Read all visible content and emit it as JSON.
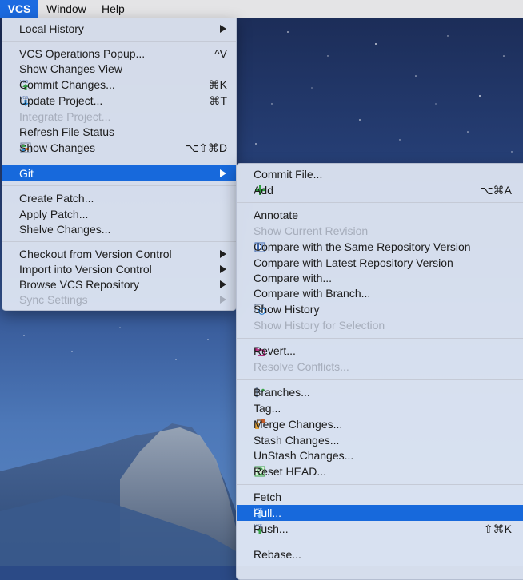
{
  "menubar": {
    "items": [
      "VCS",
      "Window",
      "Help"
    ],
    "active": "VCS"
  },
  "vcs_menu": {
    "items": [
      {
        "label": "Local History",
        "submenu": true
      },
      {
        "label": "VCS Operations Popup...",
        "shortcut": "^V"
      },
      {
        "label": "Show Changes View"
      },
      {
        "label": "Commit Changes...",
        "shortcut": "⌘K",
        "icon": "vcs-commit-icon"
      },
      {
        "label": "Update Project...",
        "shortcut": "⌘T",
        "icon": "vcs-update-icon"
      },
      {
        "label": "Integrate Project...",
        "disabled": true
      },
      {
        "label": "Refresh File Status"
      },
      {
        "label": "Show Changes",
        "shortcut": "⌥⇧⌘D",
        "icon": "show-changes-icon"
      },
      {
        "label": "Git",
        "submenu": true,
        "highlighted": true
      },
      {
        "label": "Create Patch..."
      },
      {
        "label": "Apply Patch..."
      },
      {
        "label": "Shelve Changes..."
      },
      {
        "label": "Checkout from Version Control",
        "submenu": true
      },
      {
        "label": "Import into Version Control",
        "submenu": true
      },
      {
        "label": "Browse VCS Repository",
        "submenu": true
      },
      {
        "label": "Sync Settings",
        "submenu": true,
        "disabled": true
      }
    ]
  },
  "git_menu": {
    "items": [
      {
        "label": "Commit File..."
      },
      {
        "label": "Add",
        "shortcut": "⌥⌘A",
        "icon": "plus-icon"
      },
      {
        "label": "Annotate"
      },
      {
        "label": "Show Current Revision",
        "disabled": true
      },
      {
        "label": "Compare with the Same Repository Version",
        "icon": "compare-icon"
      },
      {
        "label": "Compare with Latest Repository Version"
      },
      {
        "label": "Compare with..."
      },
      {
        "label": "Compare with Branch..."
      },
      {
        "label": "Show History",
        "icon": "history-icon"
      },
      {
        "label": "Show History for Selection",
        "disabled": true
      },
      {
        "label": "Revert...",
        "icon": "revert-icon"
      },
      {
        "label": "Resolve Conflicts...",
        "disabled": true
      },
      {
        "label": "Branches...",
        "icon": "branches-icon"
      },
      {
        "label": "Tag..."
      },
      {
        "label": "Merge Changes...",
        "icon": "merge-icon"
      },
      {
        "label": "Stash Changes..."
      },
      {
        "label": "UnStash Changes..."
      },
      {
        "label": "Reset HEAD...",
        "icon": "reset-head-icon"
      },
      {
        "label": "Fetch"
      },
      {
        "label": "Pull...",
        "icon": "pull-icon",
        "highlighted": true
      },
      {
        "label": "Push...",
        "shortcut": "⇧⌘K",
        "icon": "push-icon"
      },
      {
        "label": "Rebase..."
      }
    ]
  },
  "colors": {
    "highlight": "#1769dc",
    "menubar_active": "#1b6be1",
    "disabled_text": "#a6adbb"
  }
}
